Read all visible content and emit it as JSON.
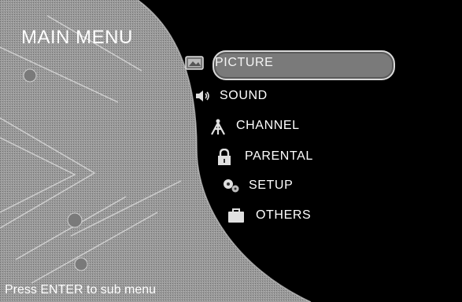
{
  "screen": {
    "title": "MAIN MENU",
    "hint": "Press ENTER to sub menu"
  },
  "menu": {
    "items": [
      {
        "label": "PICTURE",
        "icon": "picture-icon",
        "selected": true
      },
      {
        "label": "SOUND",
        "icon": "speaker-icon",
        "selected": false
      },
      {
        "label": "CHANNEL",
        "icon": "antenna-icon",
        "selected": false
      },
      {
        "label": "PARENTAL",
        "icon": "lock-icon",
        "selected": false
      },
      {
        "label": "SETUP",
        "icon": "gears-icon",
        "selected": false
      },
      {
        "label": "OTHERS",
        "icon": "toolbox-icon",
        "selected": false
      }
    ]
  },
  "colors": {
    "background_gray": "#8c8c8c",
    "panel_black": "#000000",
    "text": "#ffffff",
    "highlight": "#7a7a7a"
  }
}
